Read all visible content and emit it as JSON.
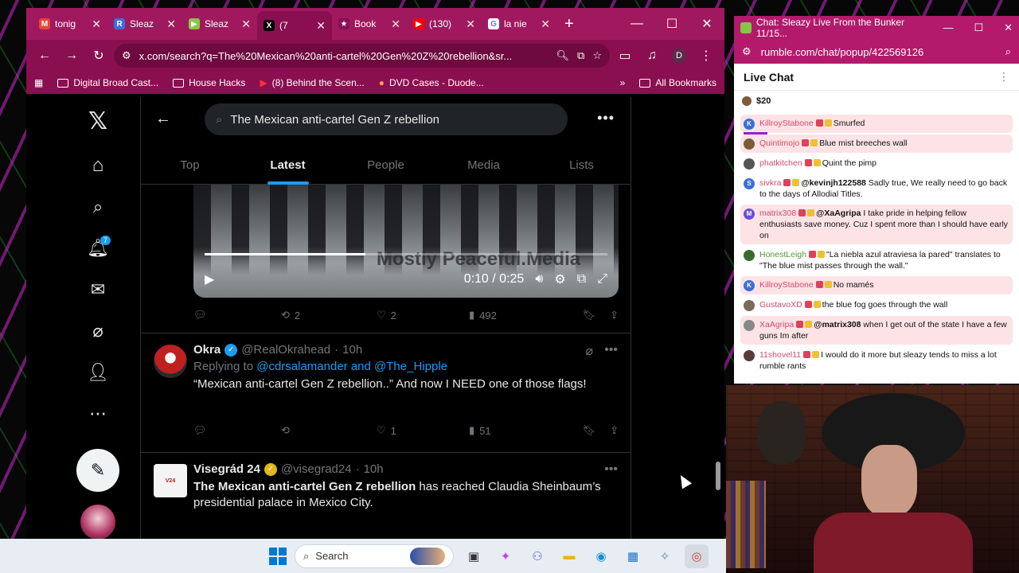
{
  "browser": {
    "tabs": [
      {
        "label": "tonig",
        "favicon": "M",
        "color": "#ea4335"
      },
      {
        "label": "Sleaz",
        "favicon": "R",
        "color": "#3b6fd8"
      },
      {
        "label": "Sleaz",
        "favicon": "▶",
        "color": "#85c742"
      },
      {
        "label": "(7",
        "favicon": "X",
        "color": "#000000"
      },
      {
        "label": "Book",
        "favicon": "★",
        "color": "#8a0f51"
      },
      {
        "label": "(130)",
        "favicon": "▶",
        "color": "#ff0000"
      },
      {
        "label": "la nie",
        "favicon": "G",
        "color": "#ffffff"
      }
    ],
    "url": "x.com/search?q=The%20Mexican%20anti-cartel%20Gen%20Z%20rebellion&sr...",
    "profile_initial": "D",
    "bookmarks": [
      "Digital Broad Cast...",
      "House Hacks",
      "(8) Behind the Scen...",
      "DVD Cases - Duode..."
    ],
    "all_bookmarks": "All Bookmarks"
  },
  "x": {
    "nav": {
      "notifications_count": "7"
    },
    "search_query": "The Mexican anti-cartel Gen Z rebellion",
    "tabs": [
      "Top",
      "Latest",
      "People",
      "Media",
      "Lists"
    ],
    "active_tab": "Latest",
    "video": {
      "watermark": "Mostly Peaceful.Media",
      "time": "0:10 / 0:25",
      "progress": 0.4
    },
    "post1_actions": {
      "reposts": "2",
      "likes": "2",
      "views": "492"
    },
    "tweets": [
      {
        "name": "Okra",
        "handle": "@RealOkrahead",
        "time": "10h",
        "replying_prefix": "Replying to",
        "replying_to_1": "@cdrsalamander",
        "replying_and": "and",
        "replying_to_2": "@The_Hipple",
        "text": "“Mexican anti-cartel Gen Z rebellion..” And now I NEED one of those flags!",
        "likes": "1",
        "views": "51",
        "verified_color": "#1d9bf0"
      },
      {
        "name": "Visegrád 24",
        "handle": "@visegrad24",
        "time": "10h",
        "text_bold": "The Mexican anti-cartel Gen Z rebellion",
        "text_rest": " has reached Claudia Sheinbaum’s presidential palace in Mexico City.",
        "verified_color": "#e2b719"
      }
    ]
  },
  "rumble": {
    "window_title": "Chat: Sleazy Live From the Bunker 11/15...",
    "url": "rumble.com/chat/popup/422569126",
    "header": "Live Chat",
    "rant_amount": "$20",
    "messages": [
      {
        "user": "KillroyStabone",
        "text": "Smurfed",
        "highlight": true,
        "avatar": "K",
        "avatar_color": "#3b6fd8"
      },
      {
        "user": "Quintimojo",
        "text": "Blue mist breeches wall",
        "highlight": true,
        "avatar": "",
        "avatar_color": "#7c5a3a"
      },
      {
        "user": "phatkitchen",
        "text": "Quint the pimp",
        "highlight": false,
        "avatar": "",
        "avatar_color": "#555555"
      },
      {
        "user": "sivkra",
        "mention": "@kevinjh122588",
        "text": " Sadly true, We really need to go back to the days of Allodial Titles.",
        "highlight": false,
        "avatar": "S",
        "avatar_color": "#3b6fd8"
      },
      {
        "user": "matrix308",
        "mention": "@XaAgripa",
        "text": " I take pride in helping fellow enthusiasts save money. Cuz I spent more than I should have early on",
        "highlight": true,
        "avatar": "M",
        "avatar_color": "#6a4fd8"
      },
      {
        "user": "HonestLeigh",
        "text": "\"La niebla azul atraviesa la pared\" translates to \"The blue mist passes through the wall.\"",
        "highlight": false,
        "avatar": "",
        "avatar_color": "#3a6a30",
        "green": true
      },
      {
        "user": "KillroyStabone",
        "text": "No mamés",
        "highlight": true,
        "avatar": "K",
        "avatar_color": "#3b6fd8"
      },
      {
        "user": "GustavoXD",
        "text": "the blue fog goes through the wall",
        "highlight": false,
        "avatar": "",
        "avatar_color": "#7a6a5a"
      },
      {
        "user": "XaAgripa",
        "mention": "@matrix308",
        "text": " when I get out of the state I have a few guns Im after",
        "highlight": true,
        "avatar": "",
        "avatar_color": "#888888"
      },
      {
        "user": "11shovel11",
        "text": "I would do it more but sleazy tends to miss a lot rumble rants",
        "highlight": false,
        "avatar": "",
        "avatar_color": "#5a3a3a"
      }
    ]
  },
  "taskbar": {
    "search_label": "Search"
  }
}
